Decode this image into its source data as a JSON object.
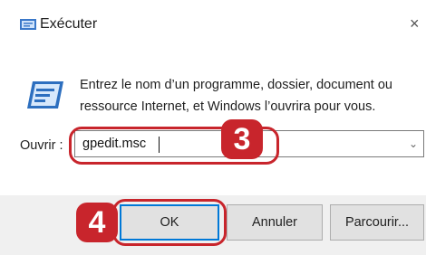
{
  "window": {
    "title": "Exécuter",
    "close_glyph": "×"
  },
  "description": {
    "line1": "Entrez le nom d’un programme, dossier, document ou",
    "line2": "ressource Internet, et Windows l’ouvrira pour vous."
  },
  "open_field": {
    "label": "Ouvrir :",
    "value": "gpedit.msc",
    "arrow": "⌄"
  },
  "buttons": {
    "ok": "OK",
    "cancel": "Annuler",
    "browse": "Parcourir..."
  },
  "badges": {
    "step3": "3",
    "step4": "4"
  },
  "icons": {
    "title_icon": "run-icon",
    "main_icon": "run-icon",
    "close_icon": "close-icon"
  },
  "colors": {
    "highlight": "#c8252c",
    "default_button_border": "#0078d7",
    "footer": "#f0f0f0"
  }
}
